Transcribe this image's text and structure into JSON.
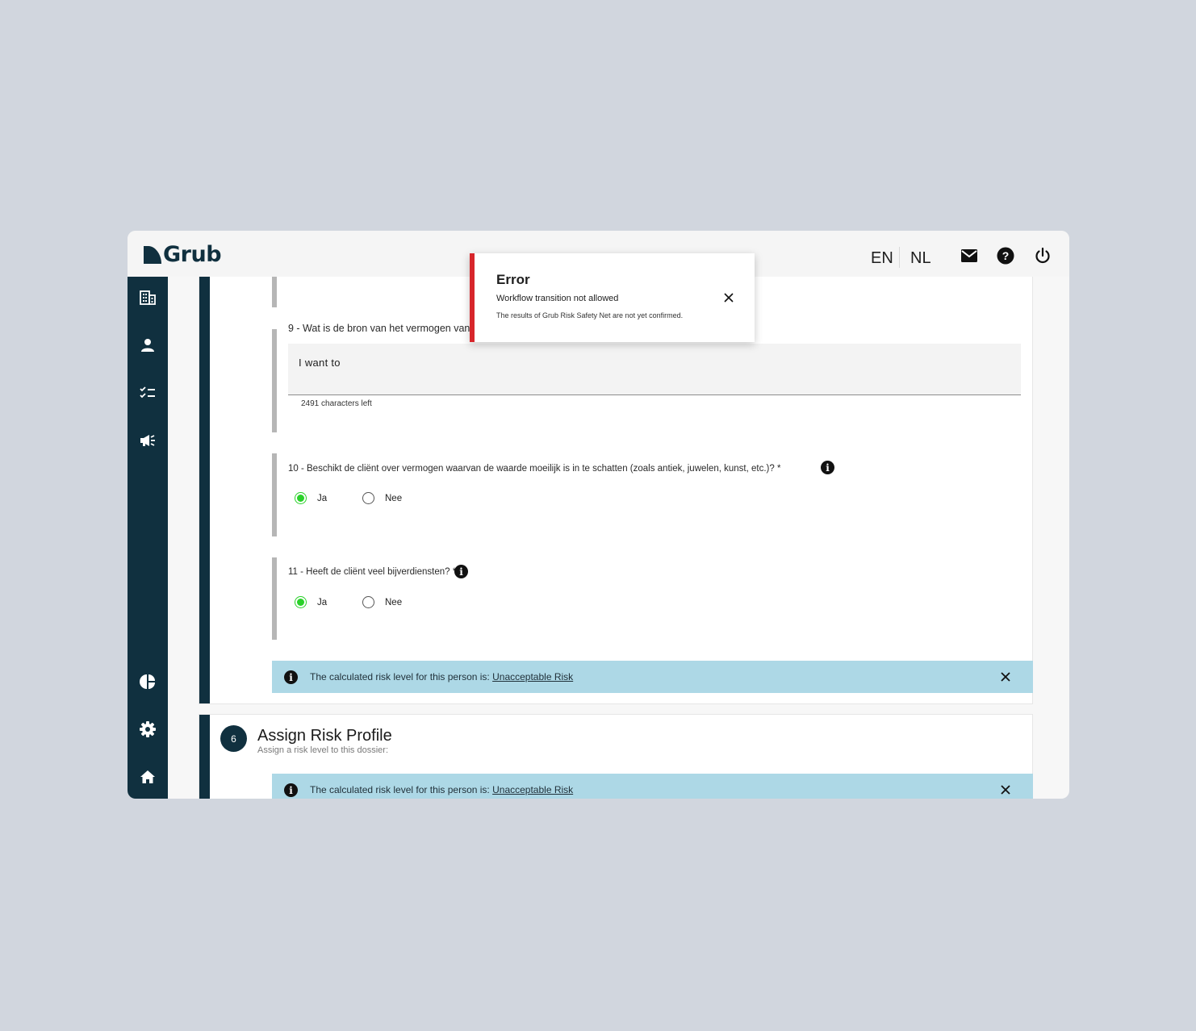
{
  "brand": {
    "name": "Grub"
  },
  "header": {
    "languages": [
      "EN",
      "NL"
    ],
    "icons": [
      "mail-icon",
      "help-icon",
      "power-icon"
    ]
  },
  "sidebar": {
    "items": [
      "building-icon",
      "person-icon",
      "checklist-icon",
      "megaphone-icon",
      "pie-chart-icon",
      "gear-icon",
      "home-icon"
    ]
  },
  "questions": {
    "q9": {
      "label": "9 - Wat is de bron van het vermogen van de cliënt?",
      "value": "I want to",
      "chars_left": "2491 characters left"
    },
    "q10": {
      "label": "10 - Beschikt de cliënt over vermogen waarvan de waarde moeilijk is in te schatten (zoals antiek, juwelen, kunst, etc.)? *",
      "options": [
        "Ja",
        "Nee"
      ],
      "selected": "Ja"
    },
    "q11": {
      "label": "11 - Heeft de cliënt veel bijverdiensten? *",
      "options": [
        "Ja",
        "Nee"
      ],
      "selected": "Ja"
    }
  },
  "risk_alert": {
    "text": "The calculated risk level for this person is: ",
    "link": "Unacceptable Risk"
  },
  "section6": {
    "number": "6",
    "title": "Assign Risk Profile",
    "subtitle": "Assign a risk level to this dossier:"
  },
  "toast": {
    "title": "Error",
    "message": "Workflow transition not allowed",
    "detail": "The results of Grub Risk Safety Net are not yet confirmed."
  },
  "colors": {
    "brand_dark": "#10303f",
    "error_red": "#d7262b",
    "radio_green": "#2ad12a",
    "alert_blue": "#add8e6"
  }
}
